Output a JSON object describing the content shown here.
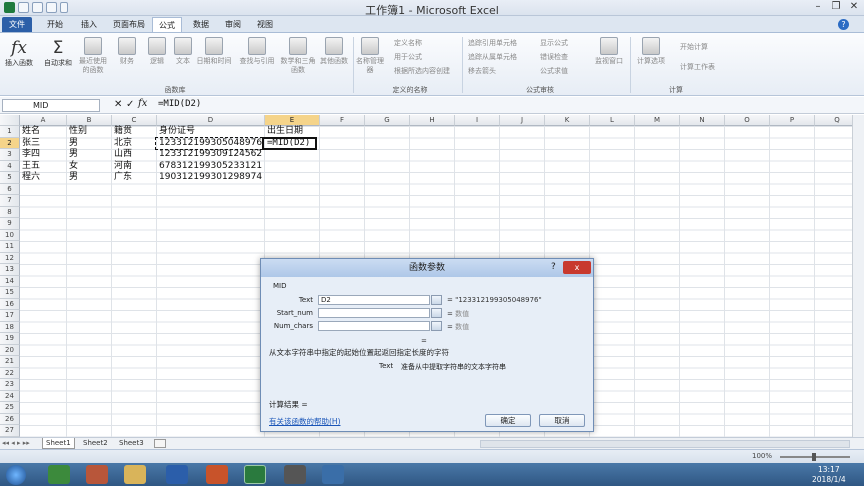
{
  "window": {
    "title": "工作簿1 - Microsoft Excel"
  },
  "tabs": [
    "文件",
    "开始",
    "插入",
    "页面布局",
    "公式",
    "数据",
    "审阅",
    "视图"
  ],
  "active_tab": "公式",
  "ribbon": {
    "insert_function": "插入函数",
    "autosum": "自动求和",
    "recent": "最近使用的函数",
    "finance": "财务",
    "logic": "逻辑",
    "text": "文本",
    "datetime": "日期和时间",
    "lookup": "查找与引用",
    "math": "数学和三角函数",
    "other": "其他函数",
    "group_library": "函数库",
    "name_mgr": "名称管理器",
    "define_name": "定义名称",
    "use_in_formula": "用于公式",
    "create_from_sel": "根据所选内容创建",
    "group_names": "定义的名称",
    "trace_prec": "追踪引用单元格",
    "trace_dep": "追踪从属单元格",
    "remove_arrows": "移去箭头",
    "show_formulas": "显示公式",
    "error_check": "错误检查",
    "eval_formula": "公式求值",
    "group_audit": "公式审核",
    "watch": "监视窗口",
    "calc_options": "计算选项",
    "calc_now": "开始计算",
    "calc_sheet": "计算工作表",
    "group_calc": "计算"
  },
  "formula_bar": {
    "name_box": "MID",
    "formula": "=MID(D2)"
  },
  "columns": [
    "A",
    "B",
    "C",
    "D",
    "E",
    "F",
    "G",
    "H",
    "I",
    "J",
    "K",
    "L",
    "M",
    "N",
    "O",
    "P",
    "Q"
  ],
  "rows": [
    "1",
    "2",
    "3",
    "4",
    "5",
    "6",
    "7",
    "8",
    "9",
    "10",
    "11",
    "12",
    "13",
    "14",
    "15",
    "16",
    "17",
    "18",
    "19",
    "20",
    "21",
    "22",
    "23",
    "24",
    "25",
    "26",
    "27"
  ],
  "table": [
    [
      "姓名",
      "性别",
      "籍贯",
      "身份证号",
      "出生日期"
    ],
    [
      "张三",
      "男",
      "北京",
      "123312199305048976",
      "=MID(D2)"
    ],
    [
      "李四",
      "男",
      "山西",
      "123312199309124562",
      ""
    ],
    [
      "王五",
      "女",
      "河南",
      "678312199305233121",
      ""
    ],
    [
      "程六",
      "男",
      "广东",
      "190312199301298974",
      ""
    ]
  ],
  "sheets": [
    "Sheet1",
    "Sheet2",
    "Sheet3"
  ],
  "status": {
    "zoom": "100%"
  },
  "taskbar": {
    "time": "13:17",
    "date": "2018/1/4"
  },
  "dialog": {
    "title": "函数参数",
    "func": "MID",
    "args": [
      {
        "label": "Text",
        "value": "D2",
        "result": "\"123312199305048976\""
      },
      {
        "label": "Start_num",
        "value": "",
        "result": "数值"
      },
      {
        "label": "Num_chars",
        "value": "",
        "result": "数值"
      }
    ],
    "eq": "=",
    "description": "从文本字符串中指定的起始位置起返回指定长度的字符",
    "arg_help_name": "Text",
    "arg_help": "准备从中提取字符串的文本字符串",
    "calc_result": "计算结果 =",
    "help_link": "有关该函数的帮助(H)",
    "ok": "确定",
    "cancel": "取消",
    "help_btn": "?",
    "close_btn": "x"
  }
}
